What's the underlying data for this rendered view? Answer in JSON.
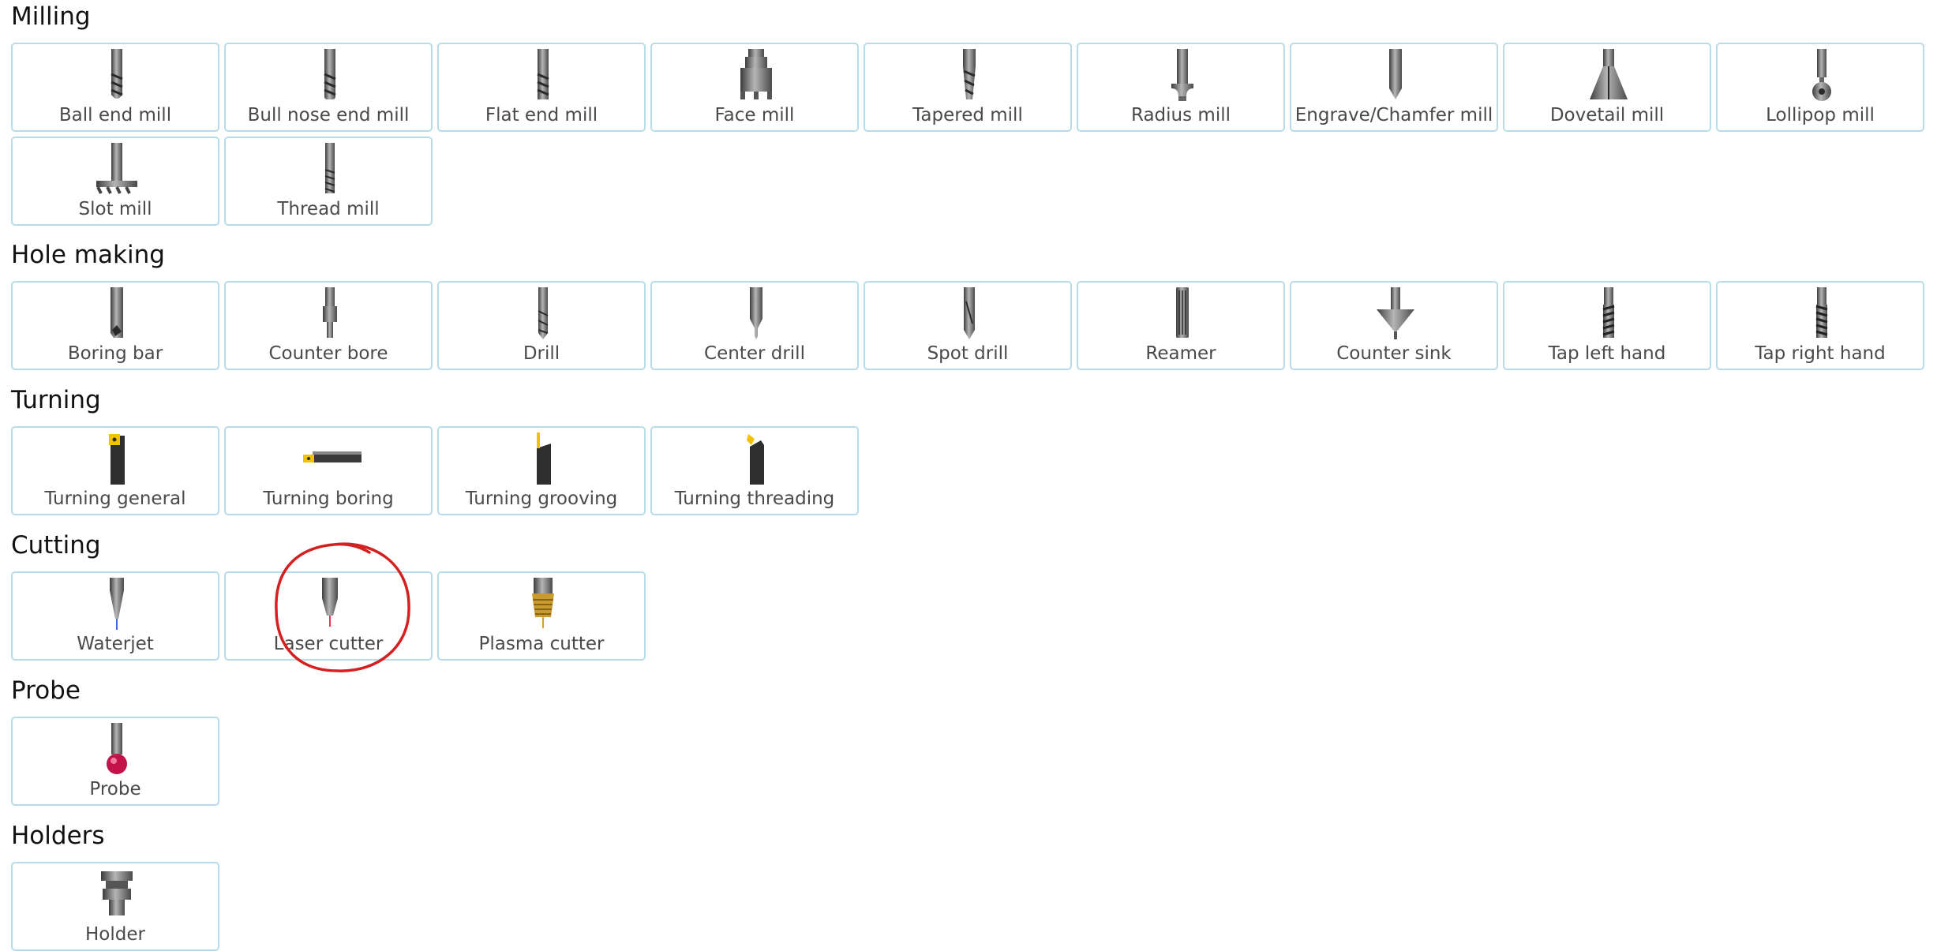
{
  "sections": [
    {
      "title": "Milling",
      "items": [
        {
          "label": "Ball end mill",
          "icon": "ball-end-mill-icon"
        },
        {
          "label": "Bull nose end mill",
          "icon": "bull-nose-end-mill-icon"
        },
        {
          "label": "Flat end mill",
          "icon": "flat-end-mill-icon"
        },
        {
          "label": "Face mill",
          "icon": "face-mill-icon"
        },
        {
          "label": "Tapered mill",
          "icon": "tapered-mill-icon"
        },
        {
          "label": "Radius mill",
          "icon": "radius-mill-icon"
        },
        {
          "label": "Engrave/Chamfer mill",
          "icon": "engrave-chamfer-mill-icon"
        },
        {
          "label": "Dovetail mill",
          "icon": "dovetail-mill-icon"
        },
        {
          "label": "Lollipop mill",
          "icon": "lollipop-mill-icon"
        },
        {
          "label": "Slot mill",
          "icon": "slot-mill-icon"
        },
        {
          "label": "Thread mill",
          "icon": "thread-mill-icon"
        }
      ]
    },
    {
      "title": "Hole making",
      "items": [
        {
          "label": "Boring bar",
          "icon": "boring-bar-icon"
        },
        {
          "label": "Counter bore",
          "icon": "counter-bore-icon"
        },
        {
          "label": "Drill",
          "icon": "drill-icon"
        },
        {
          "label": "Center drill",
          "icon": "center-drill-icon"
        },
        {
          "label": "Spot drill",
          "icon": "spot-drill-icon"
        },
        {
          "label": "Reamer",
          "icon": "reamer-icon"
        },
        {
          "label": "Counter sink",
          "icon": "counter-sink-icon"
        },
        {
          "label": "Tap left hand",
          "icon": "tap-left-hand-icon"
        },
        {
          "label": "Tap right hand",
          "icon": "tap-right-hand-icon"
        }
      ]
    },
    {
      "title": "Turning",
      "items": [
        {
          "label": "Turning general",
          "icon": "turning-general-icon"
        },
        {
          "label": "Turning boring",
          "icon": "turning-boring-icon"
        },
        {
          "label": "Turning grooving",
          "icon": "turning-grooving-icon"
        },
        {
          "label": "Turning threading",
          "icon": "turning-threading-icon"
        }
      ]
    },
    {
      "title": "Cutting",
      "items": [
        {
          "label": "Waterjet",
          "icon": "waterjet-icon"
        },
        {
          "label": "Laser cutter",
          "icon": "laser-cutter-icon"
        },
        {
          "label": "Plasma cutter",
          "icon": "plasma-cutter-icon"
        }
      ]
    },
    {
      "title": "Probe",
      "items": [
        {
          "label": "Probe",
          "icon": "probe-icon"
        }
      ]
    },
    {
      "title": "Holders",
      "items": [
        {
          "label": "Holder",
          "icon": "holder-icon"
        }
      ]
    }
  ],
  "colors": {
    "tile_border": "#b9dce9",
    "label_text": "#4a4a4a",
    "annotation_circle": "#d42020",
    "insert_yellow": "#f2c200",
    "probe_ball": "#c4124a",
    "plasma_gold": "#c99a2e"
  }
}
